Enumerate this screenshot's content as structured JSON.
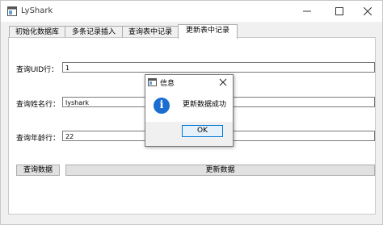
{
  "window": {
    "title": "LyShark"
  },
  "tabs": [
    {
      "label": "初始化数据库"
    },
    {
      "label": "多条记录插入"
    },
    {
      "label": "查询表中记录"
    },
    {
      "label": "更新表中记录"
    }
  ],
  "active_tab": 3,
  "form": {
    "uid_label": "查询UID行：",
    "uid_value": "1",
    "name_label": "查询姓名行：",
    "name_value": "lyshark",
    "age_label": "查询年龄行：",
    "age_value": "22"
  },
  "buttons": {
    "query": "查询数据",
    "update": "更新数据"
  },
  "dialog": {
    "title": "信息",
    "message": "更新数据成功",
    "ok": "OK",
    "icon": "info-icon"
  }
}
